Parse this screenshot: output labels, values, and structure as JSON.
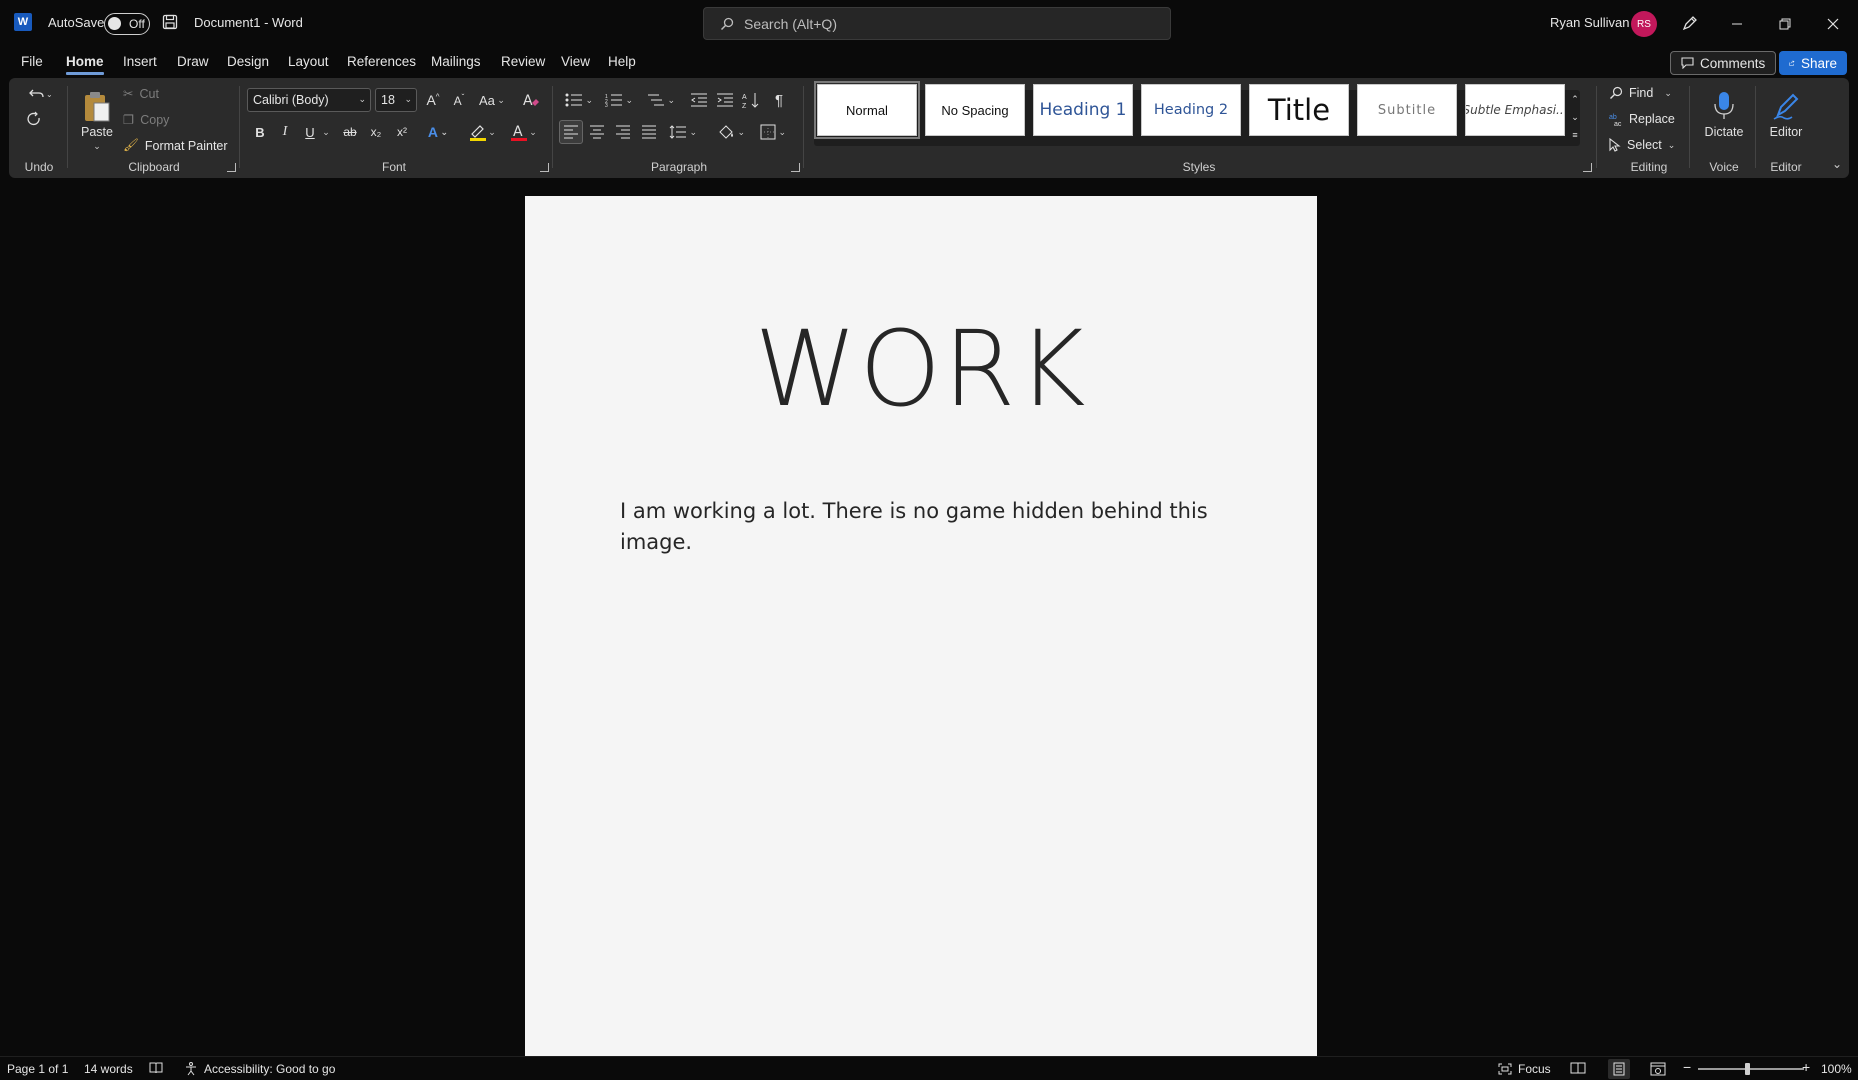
{
  "titlebar": {
    "app_logo": "W",
    "autosave_label": "AutoSave",
    "autosave_state": "Off",
    "doc_title": "Document1  -  Word",
    "search_placeholder": "Search (Alt+Q)",
    "user_name": "Ryan Sullivan",
    "user_initials": "RS"
  },
  "tabs": [
    "File",
    "Home",
    "Insert",
    "Draw",
    "Design",
    "Layout",
    "References",
    "Mailings",
    "Review",
    "View",
    "Help"
  ],
  "active_tab": "Home",
  "header_buttons": {
    "comments": "Comments",
    "share": "Share"
  },
  "ribbon": {
    "groups": {
      "undo": "Undo",
      "clipboard": "Clipboard",
      "font": "Font",
      "paragraph": "Paragraph",
      "styles": "Styles",
      "editing": "Editing",
      "voice": "Voice",
      "editor": "Editor"
    },
    "clipboard": {
      "paste": "Paste",
      "cut": "Cut",
      "copy": "Copy",
      "format_painter": "Format Painter"
    },
    "font": {
      "name": "Calibri (Body)",
      "size": "18",
      "change_case": "Aa",
      "bold": "B",
      "italic": "I",
      "underline": "U",
      "strike": "ab",
      "subscript": "x₂",
      "superscript": "x²",
      "text_effects": "A",
      "font_color": "A",
      "highlight_color": "#f2d600",
      "font_color_value": "#e81123"
    },
    "styles": [
      "Normal",
      "No Spacing",
      "Heading 1",
      "Heading 2",
      "Title",
      "Subtitle",
      "Subtle Emphasi..."
    ],
    "editing": {
      "find": "Find",
      "replace": "Replace",
      "select": "Select"
    },
    "voice": {
      "dictate": "Dictate"
    },
    "editor": {
      "editor": "Editor"
    }
  },
  "document": {
    "title": "WORK",
    "body": "I am working a lot. There is no game hidden behind this image."
  },
  "statusbar": {
    "page": "Page 1 of 1",
    "words": "14 words",
    "accessibility": "Accessibility: Good to go",
    "focus": "Focus",
    "zoom": "100%",
    "zoom_level": 1.0
  },
  "colors": {
    "accent": "#185abd",
    "share_button": "#1f6bd0",
    "avatar": "#c2185b",
    "heading": "#2f5597"
  }
}
